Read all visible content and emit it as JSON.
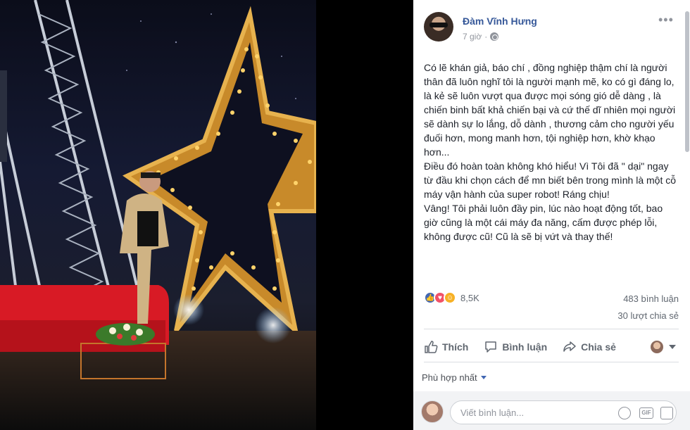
{
  "photo": {
    "alt_visible": false
  },
  "post": {
    "author": "Đàm Vĩnh Hưng",
    "time": "7 giờ",
    "paragraphs": [
      "Có lẽ khán giả, báo chí , đồng nghiệp thậm chí là người thân đã luôn nghĩ tôi là người mạnh mẽ, ko có gì đáng lo, là kẻ sẽ luôn vượt qua được mọi sóng gió dễ dàng , là chiến binh bất khả chiến bại và cứ thế dĩ nhiên mọi người sẽ dành sự lo lắng, dỗ dành , thương cảm cho người yếu đuối hơn, mong manh hơn, tội nghiệp hơn, khờ khạo hơn...",
      "Điều đó hoàn toàn không khó hiểu! Vì Tôi đã \" dại\" ngay từ đầu khi chọn cách để mn biết bên trong mình là một cỗ máy vận hành của super robot! Ráng chịu!",
      "Vâng! Tôi phải luôn đầy pin, lúc nào hoạt động tốt, bao giờ cũng là một cái máy đa năng, cấm được phép lỗi, không được cũ! Cũ là sẽ bị vứt và thay thế!"
    ],
    "reaction_count": "8,5K",
    "comments_count": "483 bình luận",
    "shares_count": "30 lượt chia sẻ"
  },
  "actions": {
    "like": "Thích",
    "comment": "Bình luận",
    "share": "Chia sẻ"
  },
  "sort": {
    "label": "Phù hợp nhất"
  },
  "comment_box": {
    "placeholder": "Viết bình luận..."
  },
  "colors": {
    "link": "#365899",
    "text": "#1d2129",
    "muted": "#90949c",
    "like": "#4267b2",
    "love": "#f25268"
  }
}
